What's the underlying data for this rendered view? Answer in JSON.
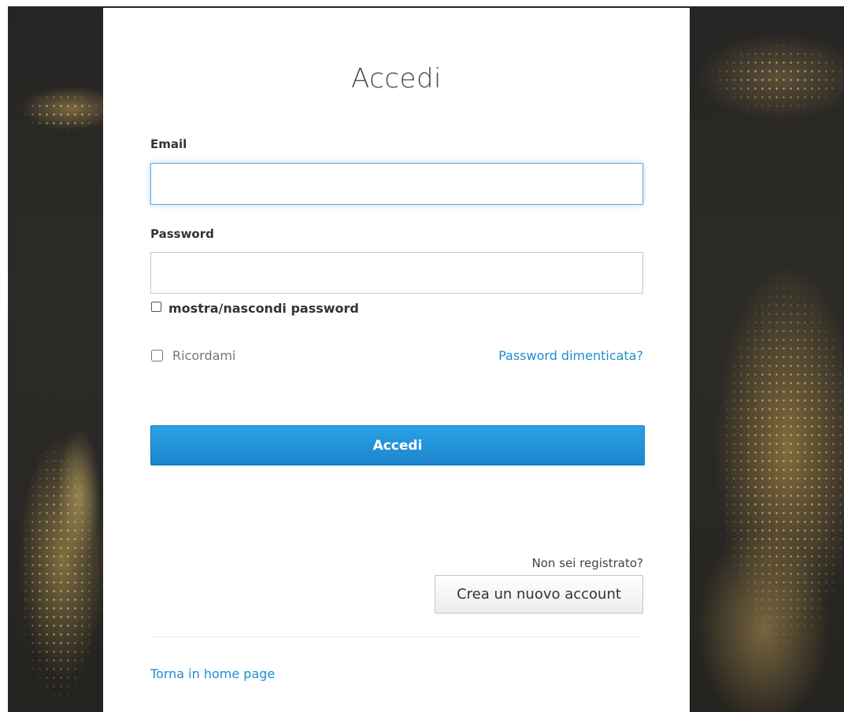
{
  "login": {
    "title": "Accedi",
    "email_label": "Email",
    "email_value": "",
    "password_label": "Password",
    "password_value": "",
    "show_password_label": "mostra/nascondi password",
    "remember_label": "Ricordami",
    "forgot_link": "Password dimenticata?",
    "submit_label": "Accedi"
  },
  "register": {
    "prompt": "Non sei registrato?",
    "button_label": "Crea un nuovo account"
  },
  "footer": {
    "home_link": "Torna in home page"
  },
  "colors": {
    "accent": "#1b85cd",
    "link": "#1f8ecf",
    "focus_border": "#66afe9"
  }
}
